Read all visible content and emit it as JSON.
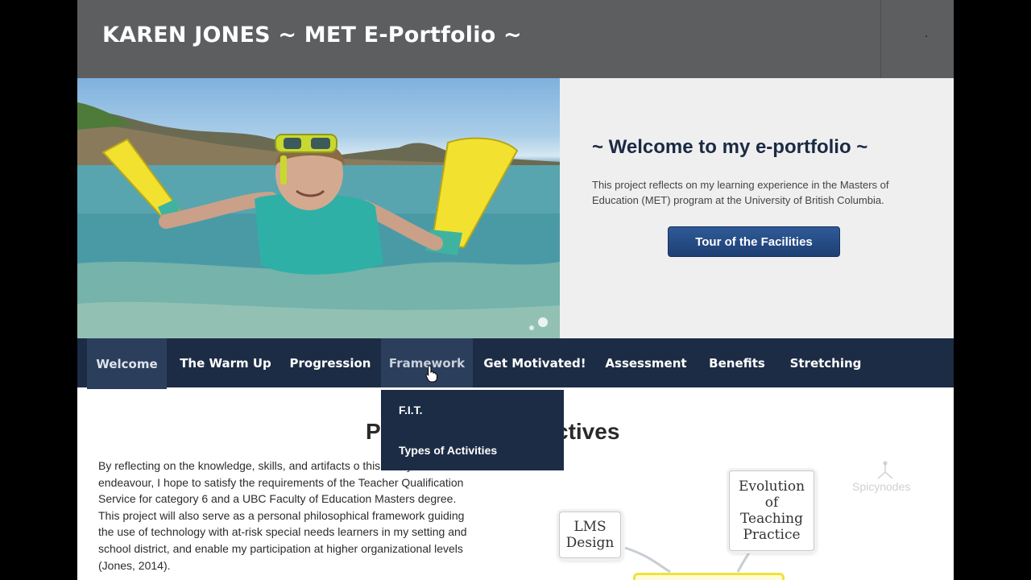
{
  "header": {
    "title": "KAREN JONES ~ MET E-Portfolio ~"
  },
  "hero": {
    "heading": "~ Welcome to my e-portfolio ~",
    "text": "This project reflects on my learning experience in the Masters of Education (MET) program at the University of British Columbia.",
    "button_label": "Tour of the Facilities"
  },
  "nav": {
    "items": [
      {
        "label": "Welcome",
        "state": "active"
      },
      {
        "label": "The Warm Up"
      },
      {
        "label": "Progression"
      },
      {
        "label": "Framework",
        "state": "hover"
      },
      {
        "label": "Get Motivated!"
      },
      {
        "label": "Assessment"
      },
      {
        "label": "Benefits"
      },
      {
        "label": "Stretching"
      }
    ],
    "dropdown": [
      {
        "label": "F.I.T."
      },
      {
        "label": "Types of Activities"
      }
    ]
  },
  "content": {
    "title": "P                         jectives",
    "body": "By reflecting on the knowledge, skills, and artifacts o          this four-year endeavour, I hope to satisfy the requirements of the Teacher Qualification Service for category 6 and a UBC Faculty of Education Masters degree.  This project will also serve as a personal philosophical framework guiding the use of technology with at-risk special needs learners in my setting and school district, and enable my participation at higher organizational levels (Jones, 2014)."
  },
  "mindmap": {
    "nodes": [
      {
        "label": "LMS Design"
      },
      {
        "label": "Evolution of Teaching Practice"
      }
    ],
    "watermark": "Spicynodes"
  },
  "colors": {
    "header_bg": "#5d5e60",
    "nav_bg": "#1d2c45",
    "button_bg": "#1d3f73",
    "heading": "#1b2a44",
    "highlight": "#f0e23a"
  }
}
